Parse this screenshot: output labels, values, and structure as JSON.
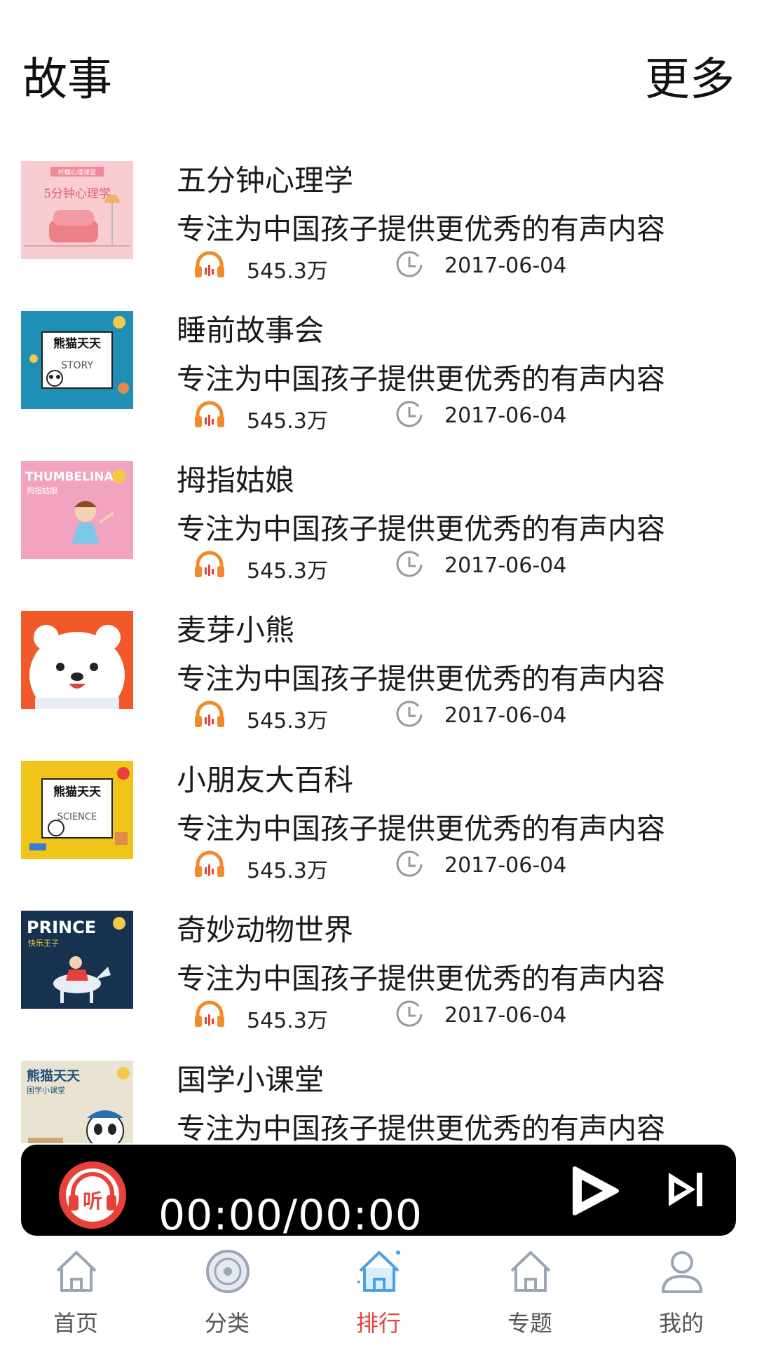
{
  "header": {
    "title": "故事",
    "more_label": "更多"
  },
  "items": [
    {
      "name": "五分钟心理学",
      "desc": "专注为中国孩子提供更优秀的有声内容",
      "plays": "545.3万",
      "date": "2017-06-04",
      "thumb_text": "5分钟心理学",
      "thumb_caption": "柠檬心理课堂"
    },
    {
      "name": "睡前故事会",
      "desc": "专注为中国孩子提供更优秀的有声内容",
      "plays": "545.3万",
      "date": "2017-06-04",
      "thumb_text": "熊猫天天",
      "thumb_caption": "STORY"
    },
    {
      "name": "拇指姑娘",
      "desc": "专注为中国孩子提供更优秀的有声内容",
      "plays": "545.3万",
      "date": "2017-06-04",
      "thumb_text": "THUMBELINA",
      "thumb_caption": "拇指姑娘"
    },
    {
      "name": "麦芽小熊",
      "desc": "专注为中国孩子提供更优秀的有声内容",
      "plays": "545.3万",
      "date": "2017-06-04"
    },
    {
      "name": "小朋友大百科",
      "desc": "专注为中国孩子提供更优秀的有声内容",
      "plays": "545.3万",
      "date": "2017-06-04",
      "thumb_text": "熊猫天天",
      "thumb_caption": "SCIENCE"
    },
    {
      "name": "奇妙动物世界",
      "desc": "专注为中国孩子提供更优秀的有声内容",
      "plays": "545.3万",
      "date": "2017-06-04",
      "thumb_text": "PRINCE",
      "thumb_caption": "快乐王子"
    },
    {
      "name": "国学小课堂",
      "desc": "专注为中国孩子提供更优秀的有声内容",
      "thumb_text": "熊猫天天",
      "thumb_caption": "国学小课堂"
    }
  ],
  "player": {
    "time": "00:00/00:00",
    "logo_text": "听"
  },
  "nav": [
    {
      "label": "首页",
      "icon": "home-icon"
    },
    {
      "label": "分类",
      "icon": "disc-icon"
    },
    {
      "label": "排行",
      "icon": "home-icon",
      "active": true
    },
    {
      "label": "专题",
      "icon": "home-icon"
    },
    {
      "label": "我的",
      "icon": "user-icon"
    }
  ],
  "colors": {
    "accent": "#e8413a",
    "player_bg": "#000000",
    "icon_gray": "#9aa5b5",
    "icon_active": "#4aa0e6"
  }
}
